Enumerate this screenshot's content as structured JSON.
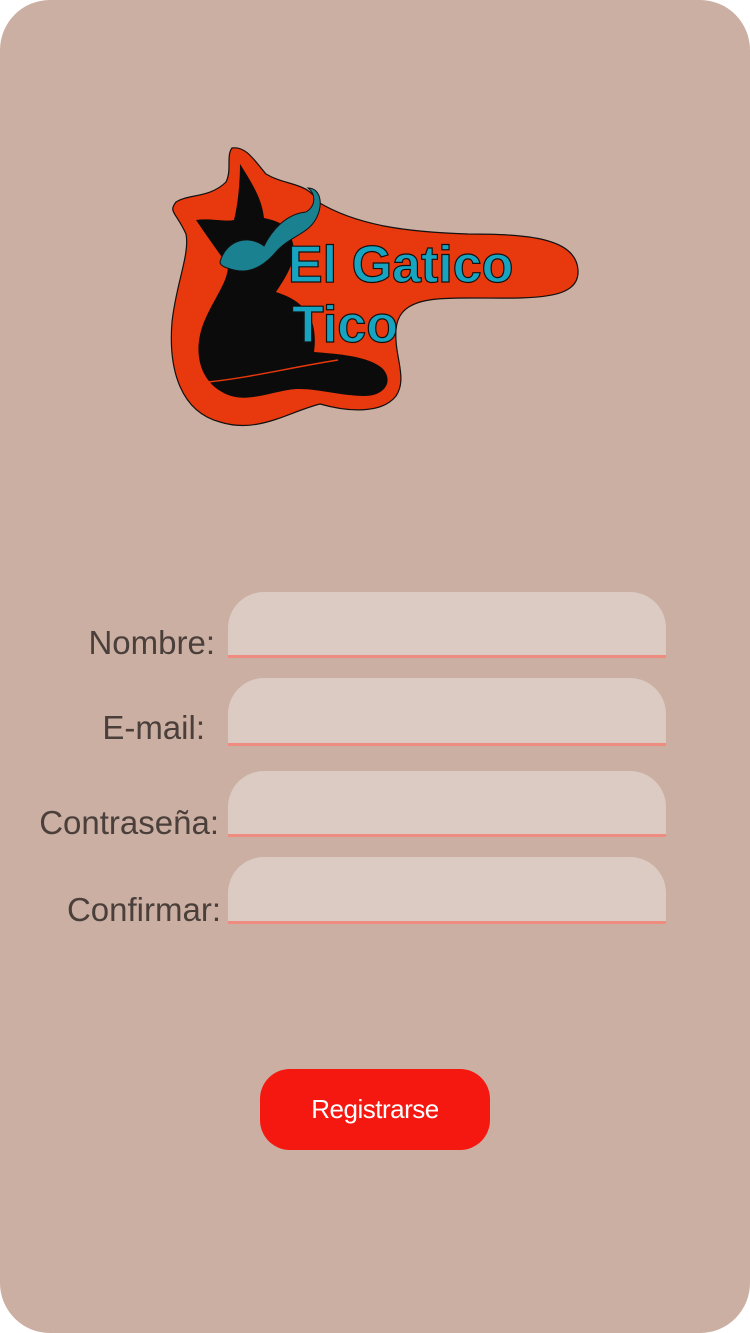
{
  "colors": {
    "background": "#cbafa2",
    "input_background": "#dccbc2",
    "input_underline": "#ef8c80",
    "button_background": "#f41810",
    "button_text": "#ffffff",
    "label_text": "#4a3f3b",
    "logo_outline": "#e8380d",
    "logo_text": "#17a4c0",
    "logo_mustache": "#1a8190",
    "logo_cat": "#0b0b0b"
  },
  "logo": {
    "line1": "El Gatico",
    "line2": "Tico",
    "icon": "cat-with-mustache-icon"
  },
  "form": {
    "fields": [
      {
        "label": "Nombre:",
        "value": "",
        "placeholder": ""
      },
      {
        "label": "E-mail:",
        "value": "",
        "placeholder": ""
      },
      {
        "label": "Contraseña:",
        "value": "",
        "placeholder": ""
      },
      {
        "label": "Confirmar:",
        "value": "",
        "placeholder": ""
      }
    ],
    "submit_label": "Registrarse"
  }
}
